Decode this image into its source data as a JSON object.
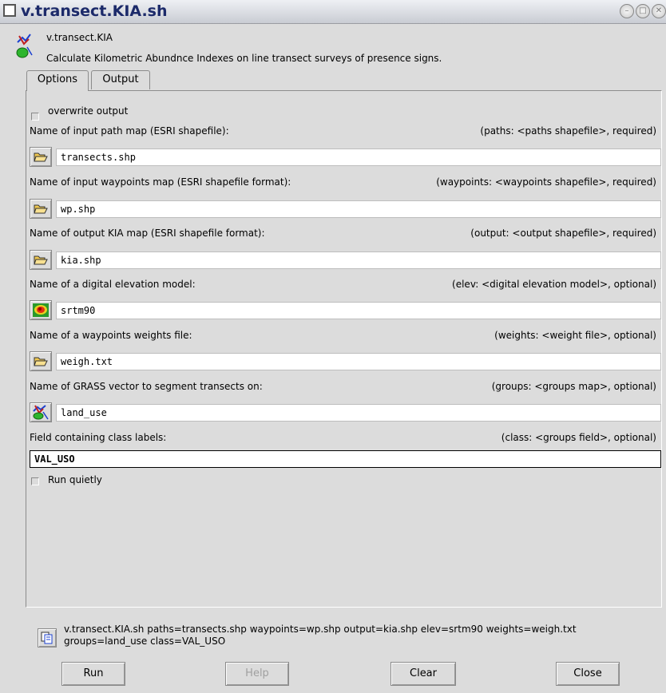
{
  "window": {
    "title": "v.transect.KIA.sh"
  },
  "header": {
    "module_name": "v.transect.KIA",
    "description": "Calculate Kilometric Abundnce Indexes on line transect surveys of presence signs."
  },
  "tabs": [
    {
      "label": "Options"
    },
    {
      "label": "Output"
    }
  ],
  "options": {
    "overwrite": {
      "label": "overwrite output",
      "checked": false
    },
    "paths": {
      "label": "Name of input path map (ESRI shapefile):",
      "hint": "(paths:  <paths shapefile>, required)",
      "value": "transects.shp"
    },
    "waypoints": {
      "label": "Name of input waypoints map (ESRI shapefile format):",
      "hint": "(waypoints:  <waypoints shapefile>, required)",
      "value": "wp.shp"
    },
    "output": {
      "label": "Name of output KIA map (ESRI shapefile format):",
      "hint": "(output:  <output shapefile>, required)",
      "value": "kia.shp"
    },
    "elev": {
      "label": "Name of a digital elevation model:",
      "hint": "(elev:  <digital elevation model>, optional)",
      "value": "srtm90"
    },
    "weights": {
      "label": "Name of a waypoints weights file:",
      "hint": "(weights:  <weight file>, optional)",
      "value": "weigh.txt"
    },
    "groups": {
      "label": "Name of GRASS vector to segment transects on:",
      "hint": "(groups:  <groups map>, optional)",
      "value": "land_use"
    },
    "class": {
      "label": "Field containing class labels:",
      "hint": "(class:  <groups field>, optional)",
      "value": "VAL_USO"
    },
    "quiet": {
      "label": "Run quietly",
      "checked": false
    }
  },
  "command": {
    "line1": "v.transect.KIA.sh paths=transects.shp waypoints=wp.shp output=kia.shp elev=srtm90 weights=weigh.txt",
    "line2": "groups=land_use class=VAL_USO"
  },
  "buttons": {
    "run": "Run",
    "help": "Help",
    "clear": "Clear",
    "close": "Close"
  }
}
